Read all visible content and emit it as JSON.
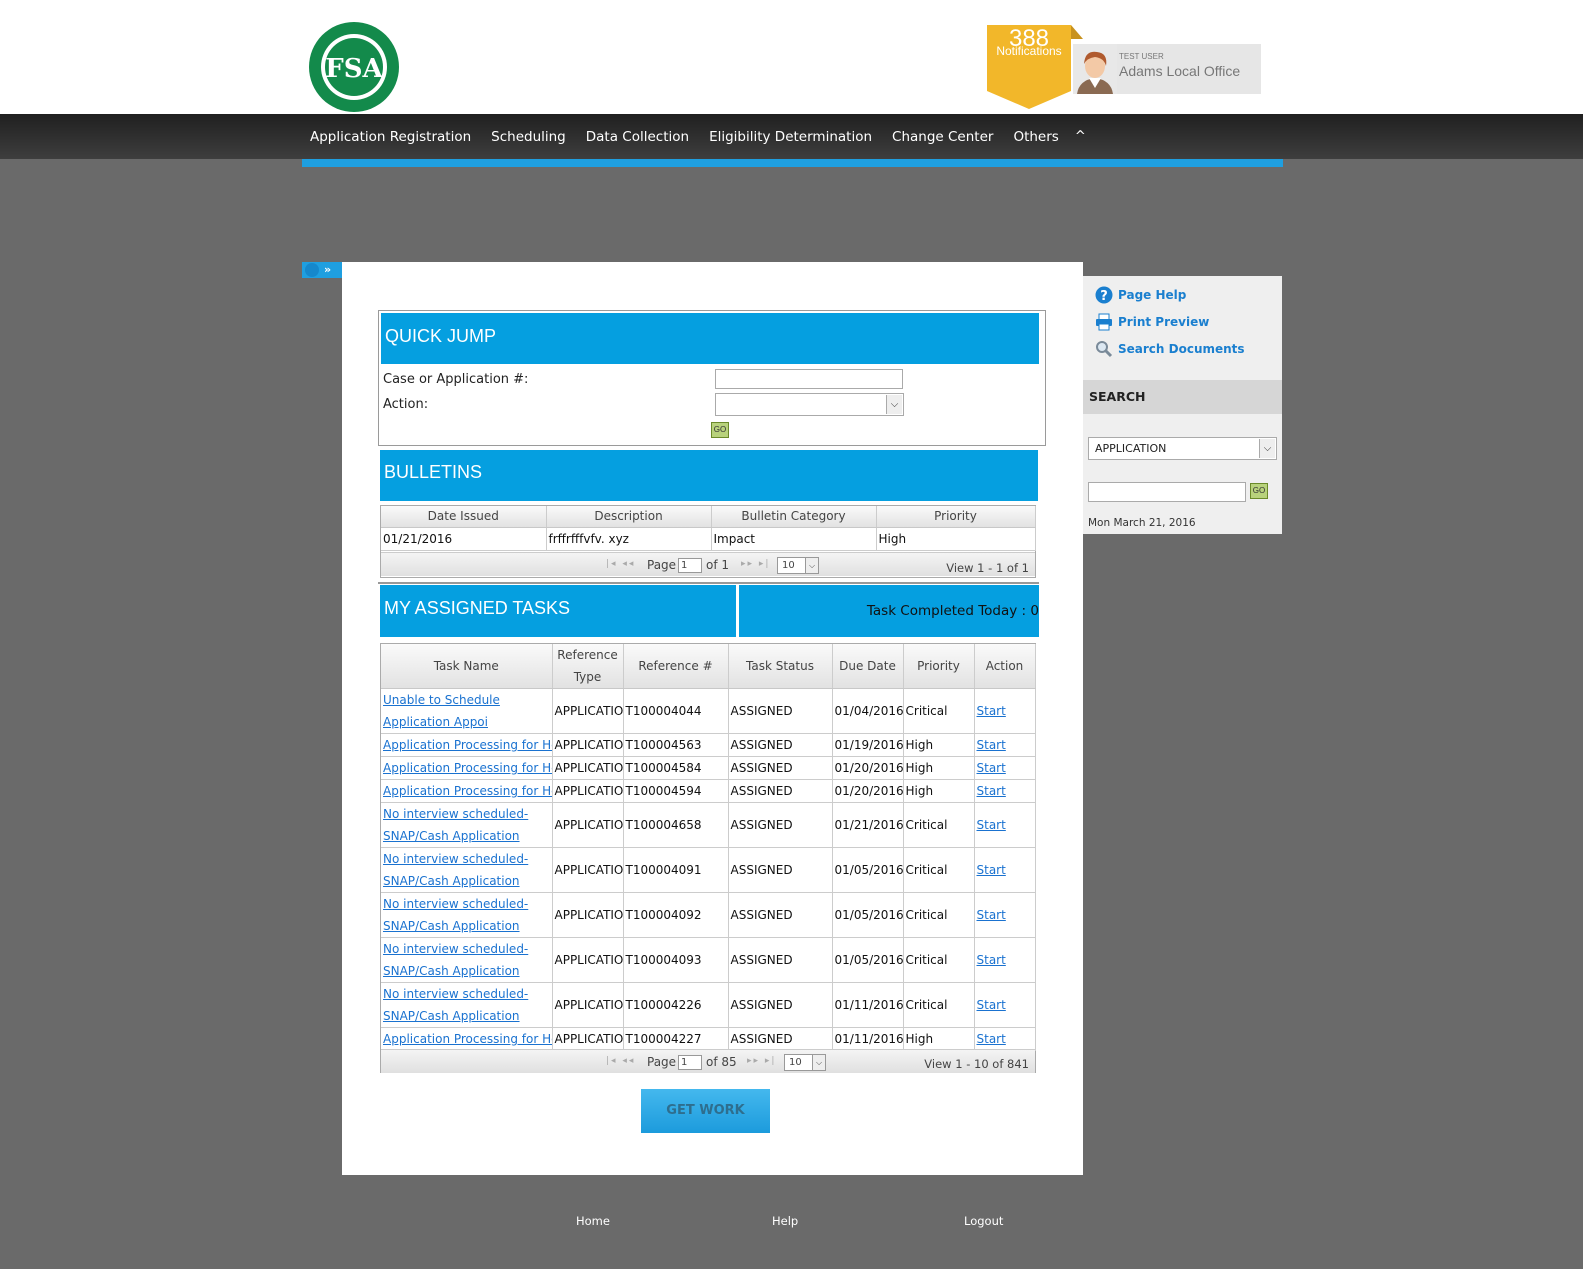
{
  "header": {
    "notifications": {
      "count": "388",
      "label": "Notifications"
    },
    "user": {
      "role": "TEST USER",
      "office": "Adams Local Office"
    }
  },
  "nav": {
    "items": [
      "Application Registration",
      "Scheduling",
      "Data Collection",
      "Eligibility Determination",
      "Change Center",
      "Others"
    ],
    "caret": "^"
  },
  "quick_jump": {
    "title": "QUICK JUMP",
    "case_label": "Case or Application #:",
    "case_value": "",
    "action_label": "Action:",
    "action_value": "",
    "go_label": "GO"
  },
  "bulletins": {
    "title": "BULLETINS",
    "columns": [
      "Date Issued",
      "Description",
      "Bulletin Category",
      "Priority"
    ],
    "rows": [
      [
        "01/21/2016",
        "frffrfffvfv. xyz",
        "Impact",
        "High"
      ]
    ],
    "pager": {
      "page_label": "Page",
      "page": "1",
      "of": "of 1",
      "per_page": "10",
      "view": "View 1 - 1 of 1"
    }
  },
  "tasks": {
    "title": "MY ASSIGNED TASKS",
    "completed_today": "Task Completed Today : 0",
    "columns": [
      "Task Name",
      "Reference Type",
      "Reference #",
      "Task Status",
      "Due Date",
      "Priority",
      "Action"
    ],
    "rows": [
      {
        "name": "Unable to Schedule Application Appoi",
        "ref_type": "APPLICATIO",
        "ref": "T100004044",
        "status": "ASSIGNED",
        "due": "01/04/2016",
        "priority": "Critical",
        "action": "Start"
      },
      {
        "name": "Application Processing for Hea",
        "ref_type": "APPLICATIO",
        "ref": "T100004563",
        "status": "ASSIGNED",
        "due": "01/19/2016",
        "priority": "High",
        "action": "Start"
      },
      {
        "name": "Application Processing for Hea",
        "ref_type": "APPLICATIO",
        "ref": "T100004584",
        "status": "ASSIGNED",
        "due": "01/20/2016",
        "priority": "High",
        "action": "Start"
      },
      {
        "name": "Application Processing for Hea",
        "ref_type": "APPLICATIO",
        "ref": "T100004594",
        "status": "ASSIGNED",
        "due": "01/20/2016",
        "priority": "High",
        "action": "Start"
      },
      {
        "name": "No interview scheduled- SNAP/Cash Application",
        "ref_type": "APPLICATIO",
        "ref": "T100004658",
        "status": "ASSIGNED",
        "due": "01/21/2016",
        "priority": "Critical",
        "action": "Start"
      },
      {
        "name": "No interview scheduled- SNAP/Cash Application",
        "ref_type": "APPLICATIO",
        "ref": "T100004091",
        "status": "ASSIGNED",
        "due": "01/05/2016",
        "priority": "Critical",
        "action": "Start"
      },
      {
        "name": "No interview scheduled- SNAP/Cash Application",
        "ref_type": "APPLICATIO",
        "ref": "T100004092",
        "status": "ASSIGNED",
        "due": "01/05/2016",
        "priority": "Critical",
        "action": "Start"
      },
      {
        "name": "No interview scheduled- SNAP/Cash Application",
        "ref_type": "APPLICATIO",
        "ref": "T100004093",
        "status": "ASSIGNED",
        "due": "01/05/2016",
        "priority": "Critical",
        "action": "Start"
      },
      {
        "name": "No interview scheduled- SNAP/Cash Application",
        "ref_type": "APPLICATIO",
        "ref": "T100004226",
        "status": "ASSIGNED",
        "due": "01/11/2016",
        "priority": "Critical",
        "action": "Start"
      },
      {
        "name": "Application Processing for Hea",
        "ref_type": "APPLICATIO",
        "ref": "T100004227",
        "status": "ASSIGNED",
        "due": "01/11/2016",
        "priority": "High",
        "action": "Start"
      }
    ],
    "pager": {
      "page_label": "Page",
      "page": "1",
      "of": "of 85",
      "per_page": "10",
      "view": "View 1 - 10 of 841"
    },
    "get_work_label": "GET WORK"
  },
  "sidebar": {
    "links": [
      {
        "label": "Page Help",
        "icon": "help-icon"
      },
      {
        "label": "Print Preview",
        "icon": "print-icon"
      },
      {
        "label": "Search Documents",
        "icon": "search-icon"
      }
    ],
    "search_title": "SEARCH",
    "search_type": "APPLICATION",
    "search_value": "",
    "go_label": "GO",
    "date": "Mon March 21, 2016"
  },
  "footer": {
    "links": [
      "Home",
      "Help",
      "Logout"
    ]
  },
  "colors": {
    "accent": "#059fe0",
    "nav_bg": "#2a2a2a",
    "page_bg": "#6a6a6a",
    "notif": "#f2b72a",
    "logo_green": "#138a4b",
    "link": "#1a72d0"
  }
}
